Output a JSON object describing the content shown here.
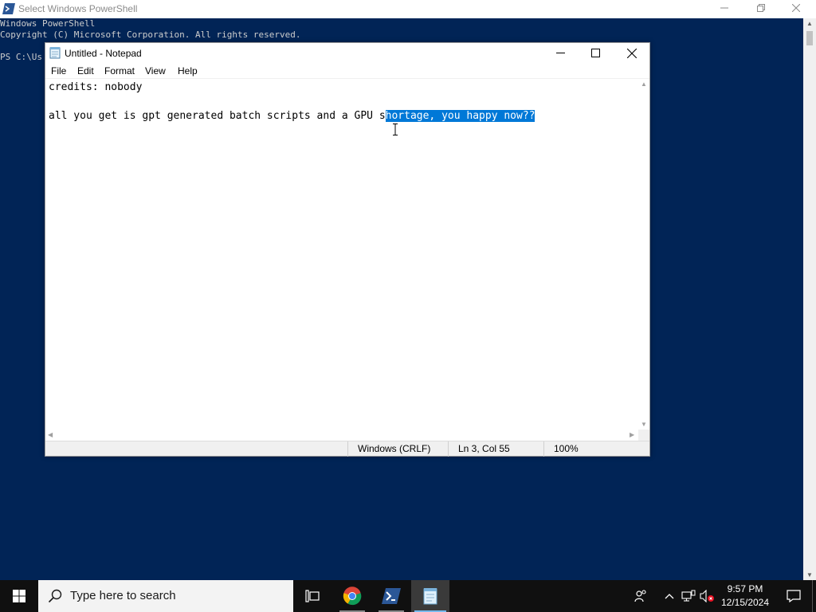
{
  "powershell": {
    "title": "Select Windows PowerShell",
    "icon": "powershell-icon",
    "controls": {
      "minimize": "minimize-icon",
      "restore": "restore-icon",
      "close": "close-icon"
    },
    "lines": [
      "Windows PowerShell",
      "Copyright (C) Microsoft Corporation. All rights reserved.",
      "",
      "PS C:\\Us"
    ]
  },
  "notepad": {
    "title": "Untitled - Notepad",
    "icon": "notepad-icon",
    "menu": [
      "File",
      "Edit",
      "Format",
      "View",
      "Help"
    ],
    "text": {
      "line1": "credits: nobody",
      "line2": "",
      "line3_unselected": "all you get is gpt generated batch scripts and a GPU s",
      "line3_selected": "hortage, you happy now??"
    },
    "status": {
      "line_ending": "Windows (CRLF)",
      "position": "Ln 3, Col 55",
      "zoom": "100%"
    }
  },
  "taskbar": {
    "search_placeholder": "Type here to search",
    "apps": [
      {
        "name": "task-view-icon"
      },
      {
        "name": "chrome-icon"
      },
      {
        "name": "powershell-icon"
      },
      {
        "name": "notepad-icon",
        "active": true
      }
    ],
    "tray": [
      "people-icon",
      "chevron-up-icon",
      "network-icon",
      "volume-muted-icon"
    ],
    "time": "9:57 PM",
    "date": "12/15/2024"
  },
  "colors": {
    "console_bg": "#012456",
    "selection": "#0078d7",
    "taskbar_bg": "#101010",
    "active_indicator": "#76b9ed"
  }
}
